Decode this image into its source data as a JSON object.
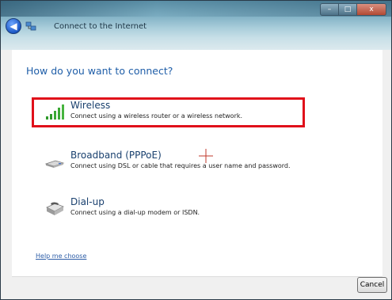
{
  "window": {
    "title": "Connect to the Internet",
    "controls": {
      "minimize": "–",
      "maximize": "□",
      "close": "x"
    }
  },
  "heading": "How do you want to connect?",
  "options": [
    {
      "title": "Wireless",
      "description": "Connect using a wireless router or a wireless network.",
      "icon": "wireless-signal-icon",
      "highlighted": true
    },
    {
      "title": "Broadband (PPPoE)",
      "description": "Connect using DSL or cable that requires a user name and password.",
      "icon": "broadband-modem-icon",
      "highlighted": false
    },
    {
      "title": "Dial-up",
      "description": "Connect using a dial-up modem or ISDN.",
      "icon": "dialup-phone-icon",
      "highlighted": false
    }
  ],
  "help_link": "Help me choose",
  "buttons": {
    "cancel": "Cancel"
  },
  "colors": {
    "highlight_border": "#e0101a",
    "heading_text": "#1f5ea8",
    "link": "#2d5da7"
  }
}
